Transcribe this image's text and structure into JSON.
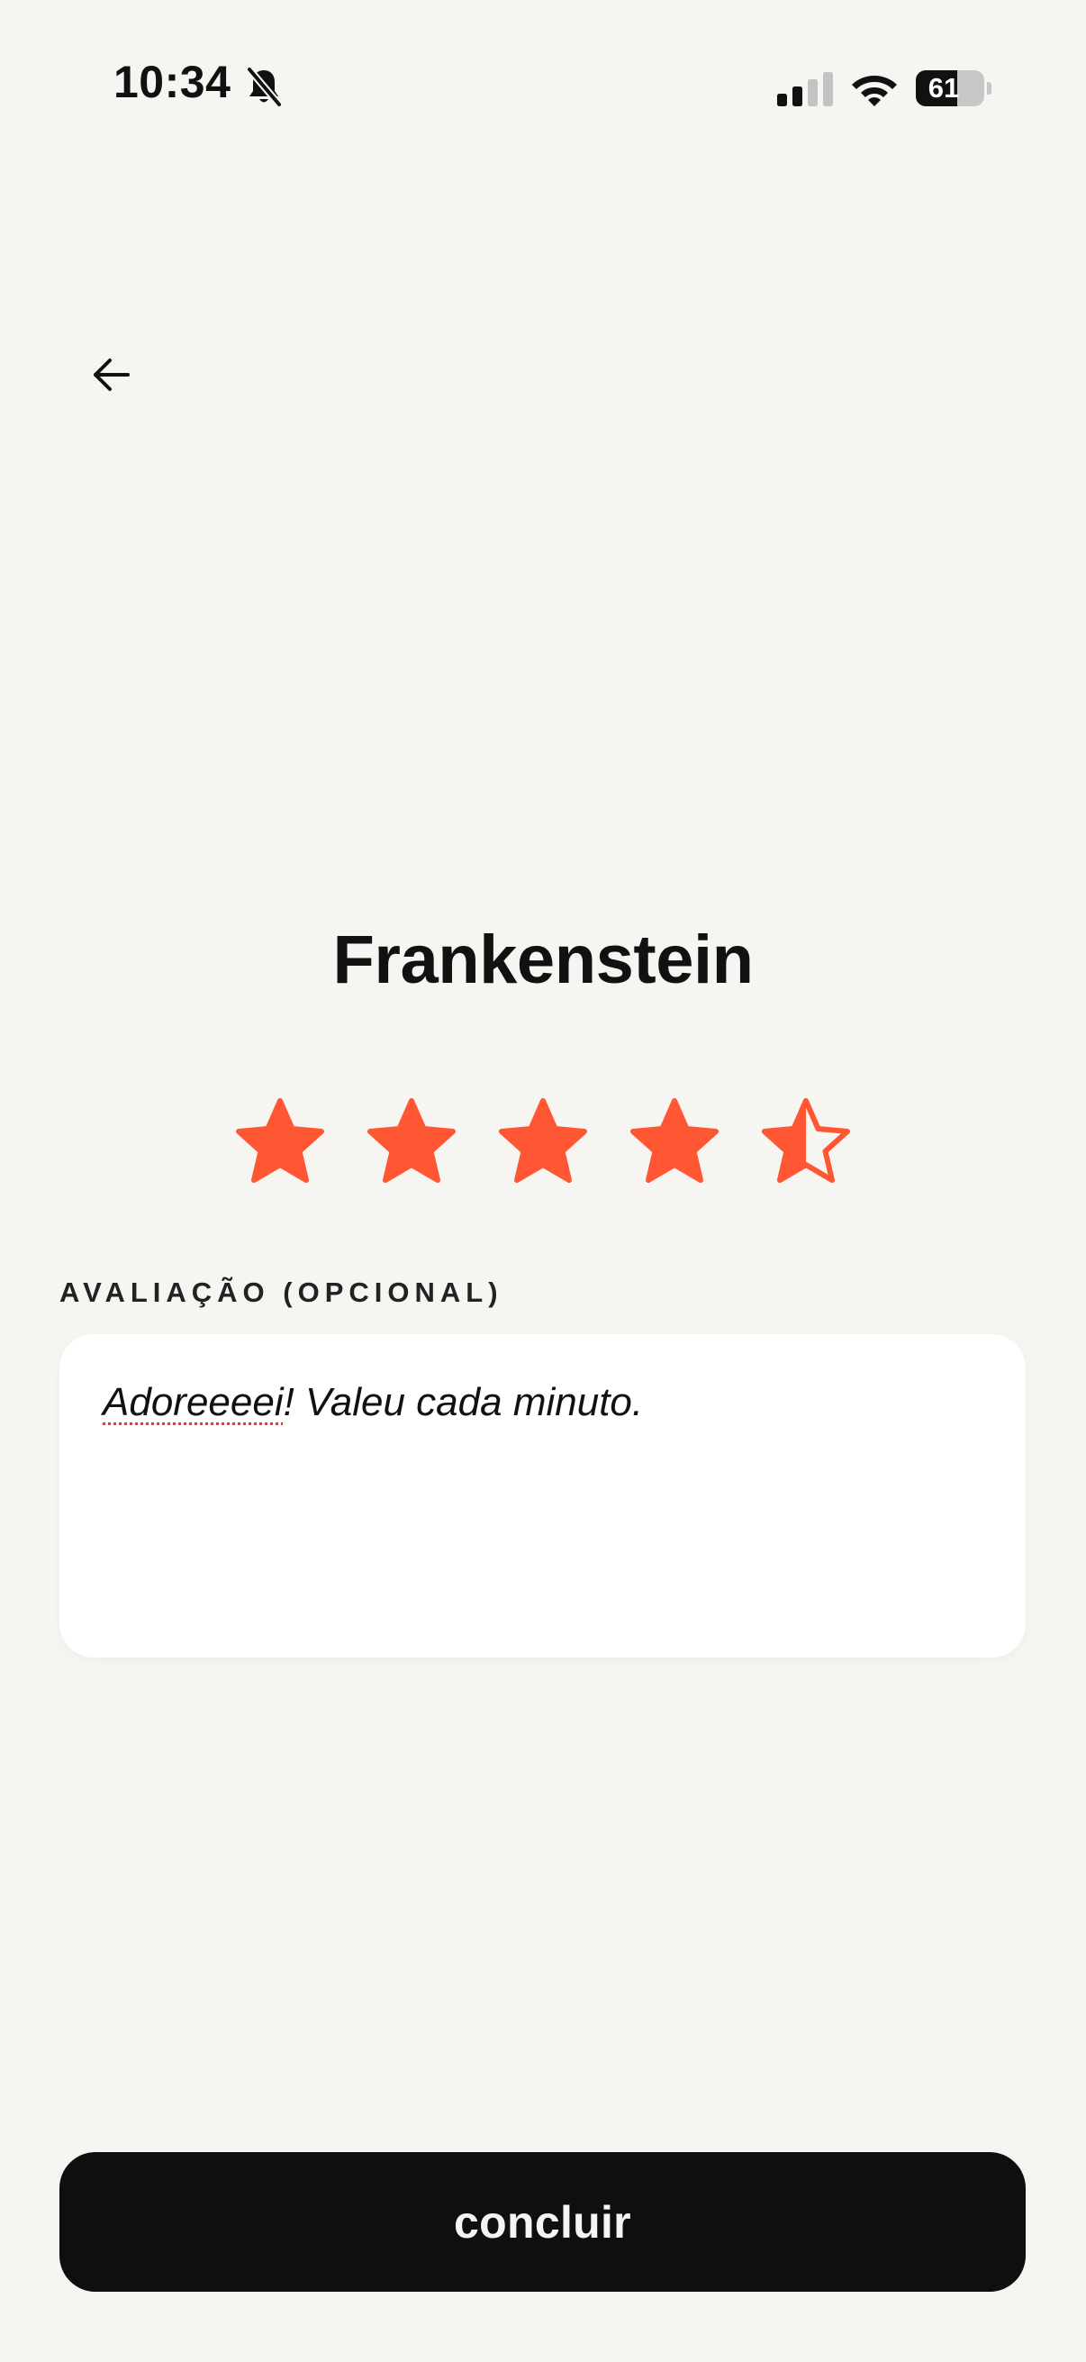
{
  "status_bar": {
    "time": "10:34",
    "battery_level": "61",
    "battery_percent": 61,
    "icons": [
      "bell-slash-icon",
      "cellular-signal-icon",
      "wifi-icon",
      "battery-icon"
    ]
  },
  "nav": {
    "back_icon": "arrow-left-icon"
  },
  "book": {
    "title": "Frankenstein"
  },
  "rating": {
    "value": 4.5,
    "max": 5,
    "color": "#ff5733"
  },
  "review": {
    "label": "AVALIAÇÃO (OPCIONAL)",
    "misspelled_word": "Adoreeeei",
    "rest_text": "! Valeu cada minuto."
  },
  "actions": {
    "finish_label": "concluir"
  },
  "colors": {
    "background": "#f6f5f2",
    "accent": "#ff5733",
    "button_background": "#0f0f0f",
    "button_text": "#f6f5f2"
  }
}
